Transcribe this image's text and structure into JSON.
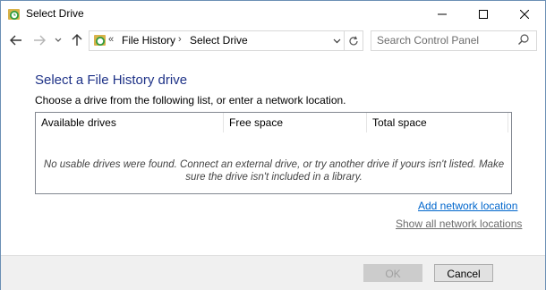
{
  "window": {
    "title": "Select Drive"
  },
  "nav": {
    "address_prefix": "«",
    "breadcrumbs": [
      "File History",
      "Select Drive"
    ],
    "separator": "›",
    "search_placeholder": "Search Control Panel"
  },
  "main": {
    "heading": "Select a File History drive",
    "instructions": "Choose a drive from the following list, or enter a network location.",
    "columns": [
      "Available drives",
      "Free space",
      "Total space"
    ],
    "empty_message": "No usable drives were found. Connect an external drive, or try another drive if yours isn't listed. Make sure the drive isn't included in a library.",
    "add_network_link": "Add network location",
    "show_all_link": "Show all network locations"
  },
  "footer": {
    "ok_label": "OK",
    "cancel_label": "Cancel"
  },
  "colors": {
    "heading": "#1e3287",
    "link": "#0066cc",
    "footer_bg": "#f0f0f0"
  }
}
